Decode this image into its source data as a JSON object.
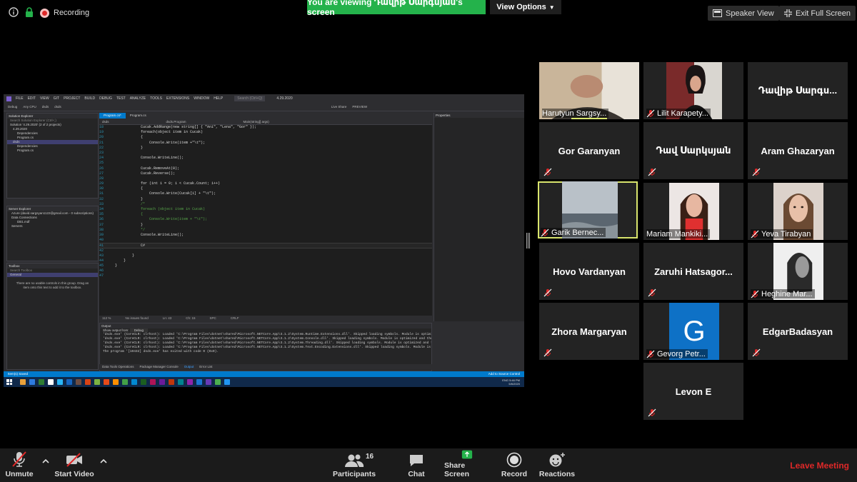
{
  "topbar": {
    "recording_label": "Recording",
    "viewing_banner": "You are viewing Դավիթ Սարգսյան's screen",
    "view_options": "View Options",
    "speaker_view": "Speaker View",
    "exit_full_screen": "Exit Full Screen"
  },
  "shared_screen": {
    "menu": [
      "FILE",
      "EDIT",
      "VIEW",
      "GIT",
      "PROJECT",
      "BUILD",
      "DEBUG",
      "TEST",
      "ANALYZE",
      "TOOLS",
      "EXTENSIONS",
      "WINDOW",
      "HELP"
    ],
    "search_placeholder": "Search (Ctrl+Q)",
    "solution_name": "4.29.2020",
    "toolbar": [
      "Debug",
      "Any CPU",
      "dsds",
      "dsds",
      "Live Share",
      "PREVIEW"
    ],
    "solution_explorer": {
      "title": "Solution Explorer",
      "search": "Search Solution Explorer (Ctrl+;)",
      "items": [
        "Solution '4.29.2020' (2 of 2 projects)",
        "4.29.2020",
        "Dependencies",
        "Program.cs",
        "dsds",
        "Dependencies",
        "Program.cs"
      ]
    },
    "server_explorer": {
      "title": "Server Explorer",
      "items": [
        "Azure (david.sargsyan1122@gmail.com - 0 subscriptions)",
        "Data Connections",
        "DB1.mdf",
        "Servers"
      ]
    },
    "toolbox": {
      "title": "Toolbox",
      "search": "Search Toolbox",
      "group": "General",
      "message": "There are no usable controls in this group. Drag an item onto this text to add it to the toolbox."
    },
    "editor_tabs": [
      "Program.cs*",
      "Program.cs"
    ],
    "breadcrumbs": [
      "dsds",
      "dsds.Program",
      "Main(string[] args)"
    ],
    "code_lines": [
      {
        "n": "18",
        "t": "            Cucak.AddRange(new string[] { \"Ani\", \"Lena\", \"Gor\" });"
      },
      {
        "n": "19",
        "t": "            foreach(object item in Cucak)"
      },
      {
        "n": "20",
        "t": "            {"
      },
      {
        "n": "21",
        "t": "                Console.Write(item +\"\\t\");"
      },
      {
        "n": "22",
        "t": "            }"
      },
      {
        "n": "23",
        "t": ""
      },
      {
        "n": "24",
        "t": "            Console.WriteLine();"
      },
      {
        "n": "25",
        "t": ""
      },
      {
        "n": "26",
        "t": "            Cucak.RemoveAt(0);"
      },
      {
        "n": "27",
        "t": "            Cucak.Reverse();"
      },
      {
        "n": "28",
        "t": ""
      },
      {
        "n": "29",
        "t": "            for (int i = 0; i < Cucak.Count; i++)"
      },
      {
        "n": "30",
        "t": "            {"
      },
      {
        "n": "31",
        "t": "                Console.Write(Cucak[i] + \"\\t\");"
      },
      {
        "n": "32",
        "t": "            }"
      },
      {
        "n": "33",
        "t": "            /*"
      },
      {
        "n": "34",
        "t": "            foreach (object item in Cucak)"
      },
      {
        "n": "35",
        "t": "            {"
      },
      {
        "n": "36",
        "t": "                Console.Write(item + \"\\t\");"
      },
      {
        "n": "37",
        "t": "            }"
      },
      {
        "n": "38",
        "t": "            */"
      },
      {
        "n": "39",
        "t": "            Console.WriteLine();"
      },
      {
        "n": "40",
        "t": ""
      },
      {
        "n": "41",
        "t": "            C#"
      },
      {
        "n": "42",
        "t": ""
      },
      {
        "n": "43",
        "t": "        }"
      },
      {
        "n": "44",
        "t": "    }"
      },
      {
        "n": "45",
        "t": "}"
      },
      {
        "n": "46",
        "t": ""
      },
      {
        "n": "47",
        "t": ""
      }
    ],
    "editor_status": [
      "112 %",
      "No issues found",
      "Ln: 43",
      "Ch: 15",
      "SPC",
      "CRLF"
    ],
    "properties_title": "Properties",
    "output": {
      "title": "Output",
      "show_from_label": "Show output from:",
      "show_from_value": "Debug",
      "lines": [
        "'dsds.exe' (CoreCLR: clrhost): Loaded 'C:\\Program Files\\dotnet\\shared\\Microsoft.NETCore.App\\3.1.2\\System.Runtime.Extensions.dll'. Skipped loading symbols. Module is optimized",
        "'dsds.exe' (CoreCLR: clrhost): Loaded 'C:\\Program Files\\dotnet\\shared\\Microsoft.NETCore.App\\3.1.2\\System.Console.dll'. Skipped loading symbols. Module is optimized and the",
        "'dsds.exe' (CoreCLR: clrhost): Loaded 'C:\\Program Files\\dotnet\\shared\\Microsoft.NETCore.App\\3.1.2\\System.Threading.dll'. Skipped loading symbols. Module is optimized and th",
        "'dsds.exe' (CoreCLR: clrhost): Loaded 'C:\\Program Files\\dotnet\\shared\\Microsoft.NETCore.App\\3.1.2\\System.Text.Encoding.Extensions.dll'. Skipped loading symbols. Module is o",
        "The program '[10432] dsds.exe' has exited with code 0 (0x0)."
      ]
    },
    "bottom_tabs": [
      "Data Tools Operations",
      "Package Manager Console",
      "Output",
      "Error List"
    ],
    "status_left": "Item(s) Saved",
    "status_right": "Add to Source Control",
    "tray_time": "5:46 PM",
    "tray_date": "5/6/2020",
    "tray_lang": "ENG"
  },
  "participants": [
    {
      "name": "Harutyun Sargsy...",
      "video": "person-old-man",
      "speaking": true,
      "muted": false
    },
    {
      "name": "Lilit Karapety...",
      "video": "person-woman-dark",
      "muted": true
    },
    {
      "name": "Դավիթ Սարգս...",
      "center": true,
      "muted": false
    },
    {
      "name": "Gor Garanyan",
      "center": true,
      "muted": true
    },
    {
      "name": "Դավ Սարկսյան",
      "center": true,
      "muted": true
    },
    {
      "name": "Aram Ghazaryan",
      "center": true,
      "muted": true
    },
    {
      "name": "Garik Bernec...",
      "video": "sea",
      "muted": true,
      "active_speaker": true
    },
    {
      "name": "Mariam Mankiki...",
      "video": "person-girl-red",
      "muted": false
    },
    {
      "name": "Yeva Tirabyan",
      "video": "person-girl",
      "muted": true
    },
    {
      "name": "Hovo Vardanyan",
      "center": true,
      "muted": true
    },
    {
      "name": "Zaruhi  Hatsagor...",
      "center": true,
      "muted": true
    },
    {
      "name": "Heghine Mar...",
      "video": "person-bw",
      "muted": true
    },
    {
      "name": "Zhora Margaryan",
      "center": true,
      "muted": true
    },
    {
      "name": "Gevorg Petr...",
      "video": "avatar-g",
      "avatar_letter": "G",
      "muted": true
    },
    {
      "name": "EdgarBadasyan",
      "center": true,
      "muted": true
    },
    {
      "name": "Levon E",
      "center": true,
      "muted": true
    }
  ],
  "bottombar": {
    "unmute": "Unmute",
    "start_video": "Start Video",
    "participants": "Participants",
    "participants_count": "16",
    "chat": "Chat",
    "share_screen": "Share Screen",
    "record": "Record",
    "reactions": "Reactions",
    "leave": "Leave Meeting"
  },
  "colors": {
    "banner_green": "#24b24b",
    "share_green": "#24b24b",
    "leave_red": "#e02828",
    "active_speaker": "#d9e56d",
    "vs_blue": "#007acc"
  }
}
